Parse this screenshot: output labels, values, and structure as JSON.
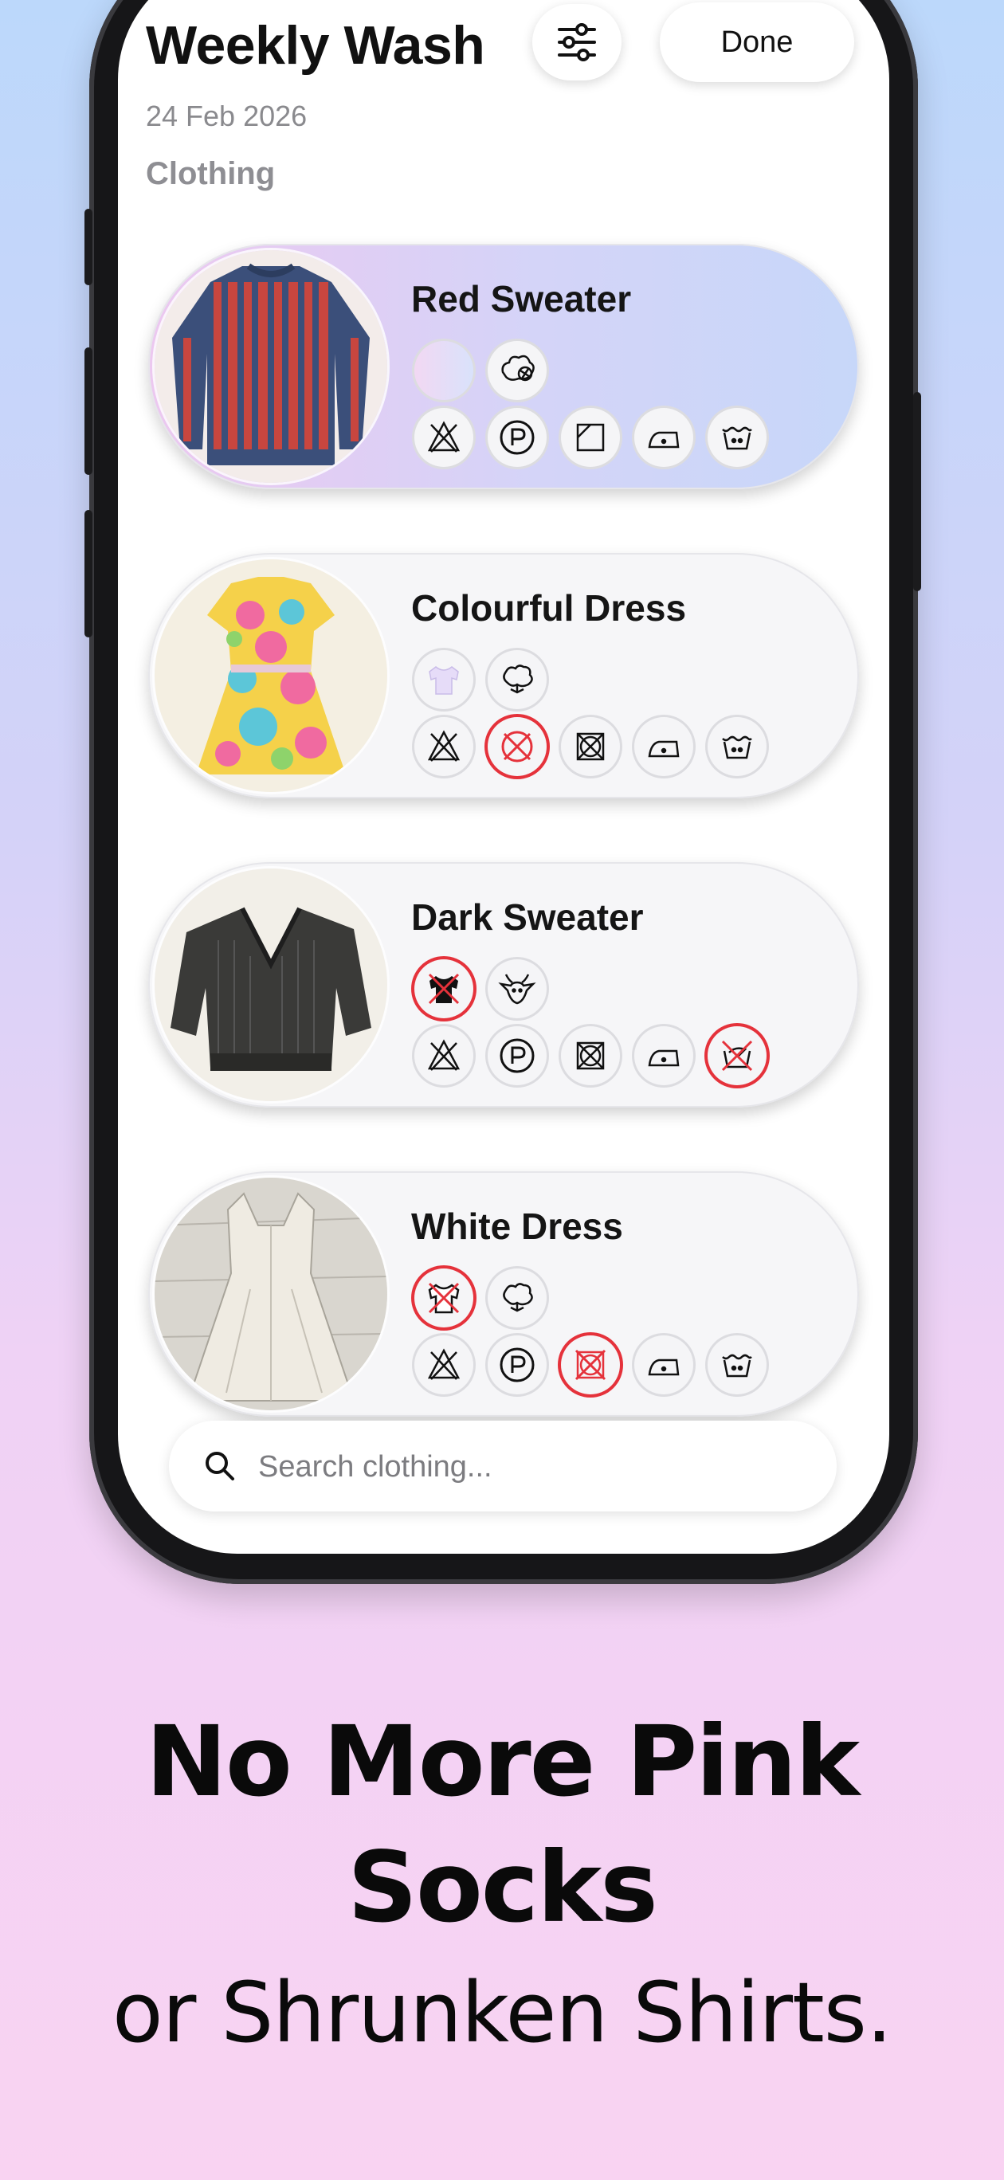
{
  "app": {
    "title": "Weekly Wash",
    "date": "24 Feb 2026",
    "section_label": "Clothing",
    "done_label": "Done",
    "filter_icon": "sliders-icon"
  },
  "clothing": [
    {
      "name": "Red Sweater",
      "highlighted": true,
      "color_chip": "light",
      "material": "wool-yarn-icon",
      "care": [
        "no-tumble-dry",
        "dry-clean-p",
        "drip-dry",
        "iron-low",
        "wash-30"
      ],
      "warnings": []
    },
    {
      "name": "Colourful Dress",
      "highlighted": false,
      "color_chip": "light-tshirt",
      "material": "cotton-icon",
      "care": [
        "no-tumble-dry",
        "no-dry-clean",
        "no-tumble-dry-square",
        "iron-low",
        "wash-30"
      ],
      "warnings": [
        "no-dry-clean"
      ]
    },
    {
      "name": "Dark Sweater",
      "highlighted": false,
      "color_chip": "dark-tshirt",
      "material": "goat-icon",
      "care": [
        "no-tumble-dry",
        "dry-clean-p",
        "no-tumble-dry-square",
        "iron-low",
        "hand-wash"
      ],
      "warnings": [
        "dark-tshirt",
        "hand-wash"
      ]
    },
    {
      "name": "White Dress",
      "highlighted": false,
      "color_chip": "white-tshirt",
      "material": "cotton-icon",
      "care": [
        "no-tumble-dry",
        "dry-clean-p",
        "no-tumble-dry-square",
        "iron-low",
        "wash-30"
      ],
      "warnings": [
        "white-tshirt",
        "no-tumble-dry-square"
      ]
    }
  ],
  "search": {
    "placeholder": "Search clothing..."
  },
  "marketing": {
    "headline_line1": "No More Pink",
    "headline_line2": "Socks",
    "subline": "or Shrunken Shirts."
  },
  "colors": {
    "accent_red": "#e5323b",
    "bg_top": "#bcd8fb",
    "bg_bottom": "#f9d3f2"
  }
}
